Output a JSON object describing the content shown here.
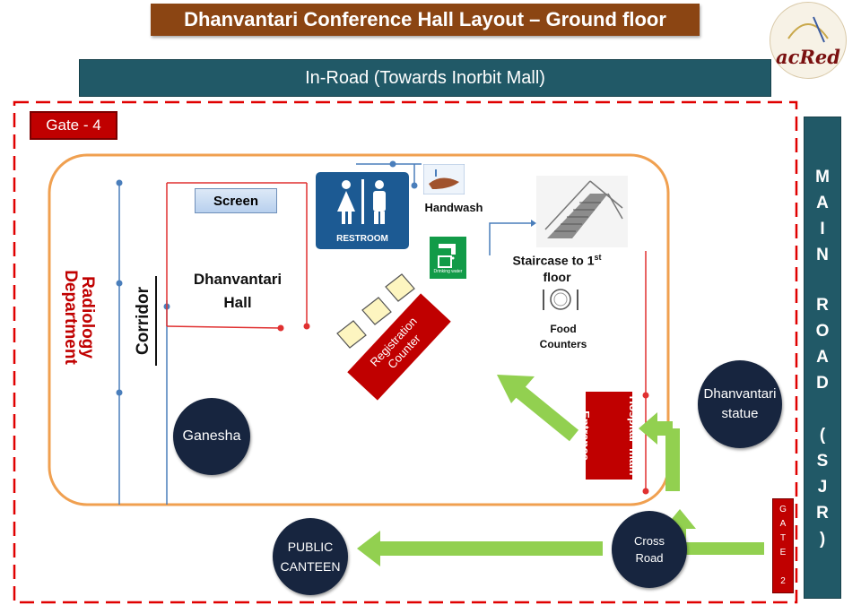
{
  "title": "Dhanvantari Conference Hall Layout – Ground floor",
  "logo_text": "acRed",
  "in_road": "In-Road  (Towards Inorbit Mall)",
  "main_road_chars": [
    "M",
    "A",
    "I",
    "N",
    "R",
    "O",
    "A",
    "D",
    "(",
    "S",
    "J",
    "R",
    ")"
  ],
  "gate4": "Gate - 4",
  "gate2_chars": [
    "G",
    "A",
    "T",
    "E",
    "2"
  ],
  "radiology_line1": "Radiology",
  "radiology_line2": "Department",
  "corridor": "Corridor",
  "screen": "Screen",
  "dhanvantari_hall_line1": "Dhanvantari",
  "dhanvantari_hall_line2": "Hall",
  "restroom": "RESTROOM",
  "handwash": "Handwash",
  "drinking_water": "Drinking water",
  "staircase_line1": "Staircase to 1",
  "staircase_sup": "st",
  "staircase_line2": "floor",
  "food_line1": "Food",
  "food_line2": "Counters",
  "registration_line1": "Registration",
  "registration_line2": "Counter",
  "hospital_line1": "Hospital  main",
  "hospital_line2": "Entrance",
  "dhanvantari_statue_line1": "Dhanvantari",
  "dhanvantari_statue_line2": "statue",
  "ganesha": "Ganesha",
  "cross_road_line1": "Cross",
  "cross_road_line2": "Road",
  "public_canteen_line1": "PUBLIC",
  "public_canteen_line2": "CANTEEN",
  "colors": {
    "banner_brown": "#8B4513",
    "road_teal": "#215967",
    "gate_red": "#c00000",
    "hall_outline": "#f0a050",
    "arrow_green": "#92d050",
    "circle_navy": "#17253f",
    "restroom_blue": "#1c5a93"
  }
}
